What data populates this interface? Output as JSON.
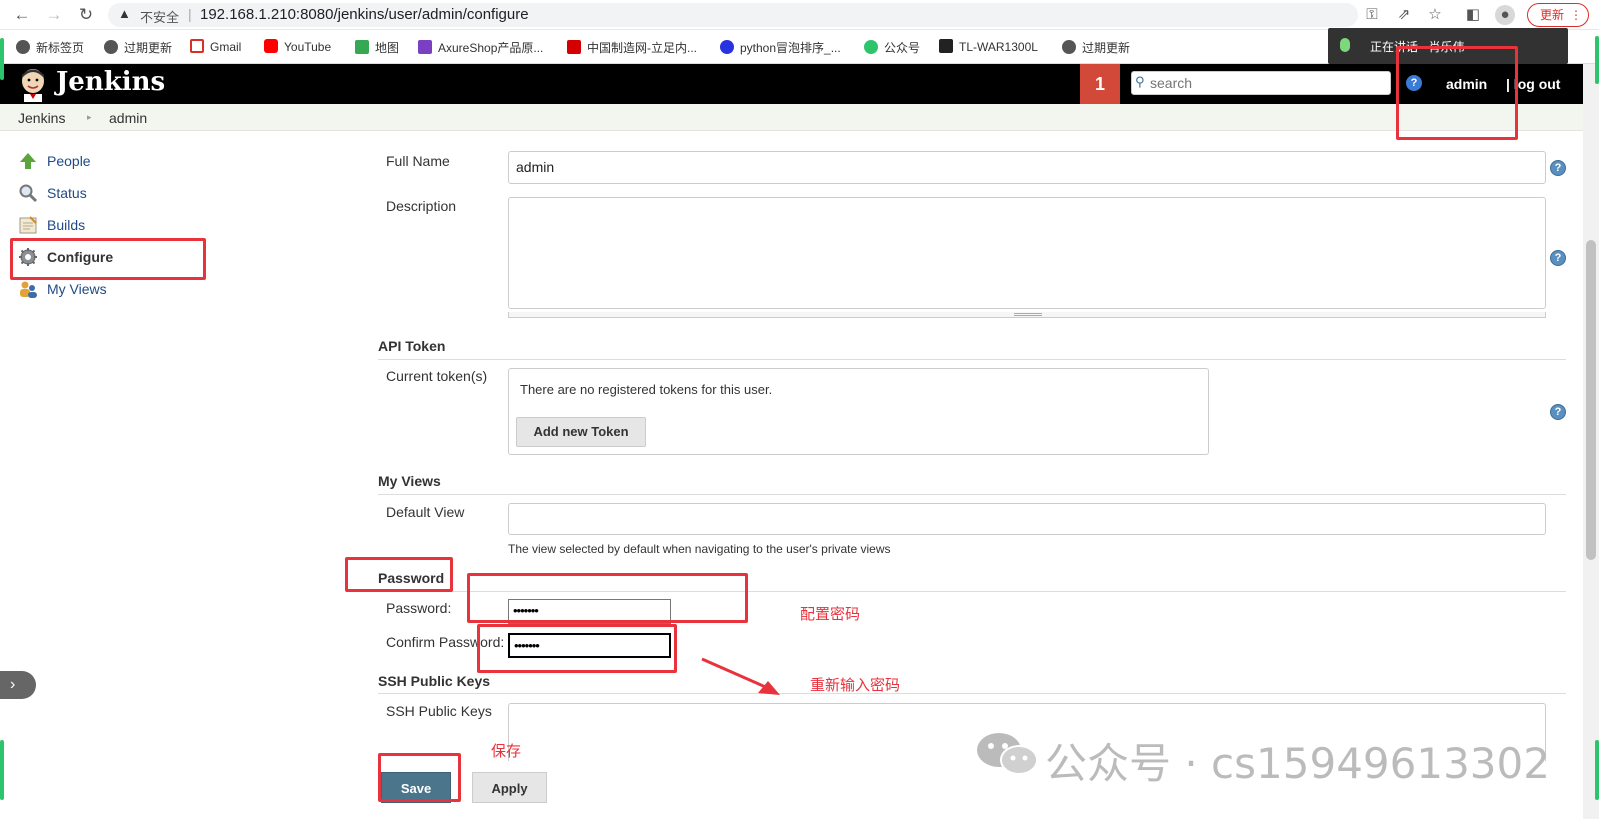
{
  "browser": {
    "insecure_label": "不安全",
    "url": "192.168.1.210:8080/jenkins/user/admin/configure",
    "update_label": "更新",
    "bookmarks": [
      {
        "label": "新标签页",
        "color": "#555555"
      },
      {
        "label": "过期更新",
        "color": "#555555"
      },
      {
        "label": "Gmail",
        "color": "#d93025"
      },
      {
        "label": "YouTube",
        "color": "#ff0000"
      },
      {
        "label": "地图",
        "color": "#34a853"
      },
      {
        "label": "AxureShop产品原...",
        "color": "#7b3fc4"
      },
      {
        "label": "中国制造网-立足内...",
        "color": "#d40000"
      },
      {
        "label": "python冒泡排序_...",
        "color": "#2932e1"
      },
      {
        "label": "公众号",
        "color": "#2ec46b"
      },
      {
        "label": "TL-WAR1300L",
        "color": "#222222"
      },
      {
        "label": "过期更新",
        "color": "#555555"
      }
    ],
    "voice_popup": "正在讲话 - 肖乐伟"
  },
  "header": {
    "title": "Jenkins",
    "notification_count": "1",
    "search_placeholder": "search",
    "help_glyph": "?",
    "user": "admin",
    "logout": "| log out"
  },
  "breadcrumb": [
    "Jenkins",
    "admin"
  ],
  "sidebar": {
    "items": [
      {
        "label": "People"
      },
      {
        "label": "Status"
      },
      {
        "label": "Builds"
      },
      {
        "label": "Configure"
      },
      {
        "label": "My Views"
      }
    ]
  },
  "form": {
    "full_name_label": "Full Name",
    "full_name_value": "admin",
    "description_label": "Description",
    "api_token_heading": "API Token",
    "current_tokens_label": "Current token(s)",
    "no_tokens_msg": "There are no registered tokens for this user.",
    "add_token_button": "Add new Token",
    "my_views_heading": "My Views",
    "default_view_label": "Default View",
    "default_view_hint": "The view selected by default when navigating to the user's private views",
    "password_heading": "Password",
    "password_label": "Password:",
    "password_mask": "•••••••",
    "confirm_password_label": "Confirm Password:",
    "confirm_password_mask": "•••••••",
    "ssh_heading": "SSH Public Keys",
    "ssh_label": "SSH Public Keys",
    "save_button": "Save",
    "apply_button": "Apply"
  },
  "annotations": {
    "configure_password": "配置密码",
    "reenter_password": "重新输入密码",
    "save_note": "保存",
    "annotation_color": "#e8323c"
  },
  "watermark": "公众号 · cs15949613302"
}
